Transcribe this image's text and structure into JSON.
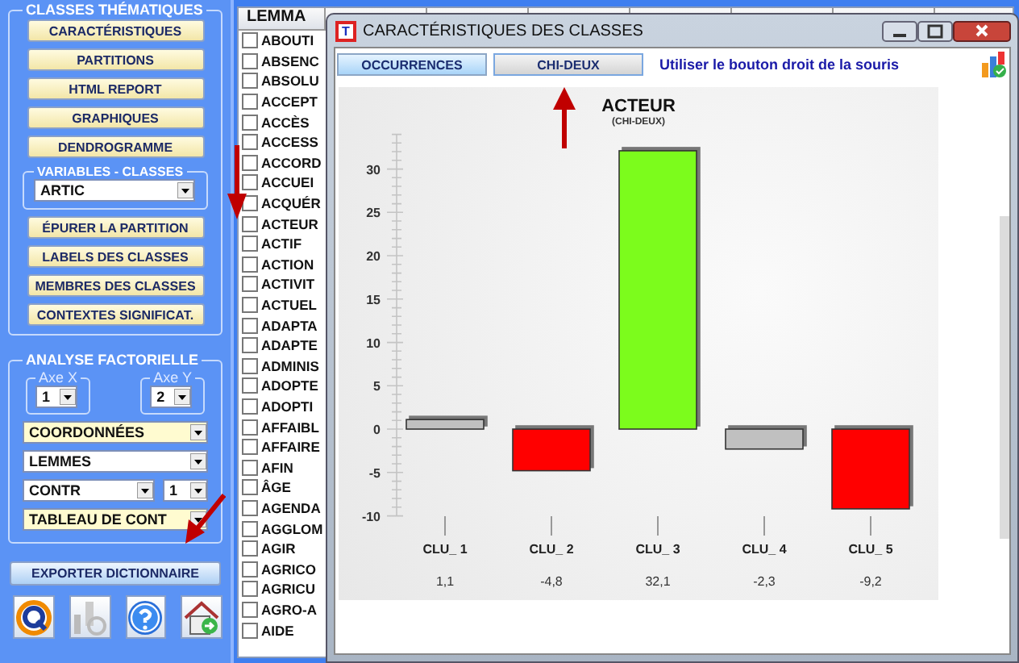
{
  "sidebar": {
    "section_title": "CLASSES THÉMATIQUES",
    "top_buttons": [
      "CARACTÉRISTIQUES",
      "PARTITIONS",
      "HTML REPORT",
      "GRAPHIQUES",
      "DENDROGRAMME"
    ],
    "variables": {
      "title": "VARIABLES - CLASSES",
      "value": "ARTIC"
    },
    "bottom_buttons": [
      "ÉPURER LA PARTITION",
      "LABELS DES CLASSES",
      "MEMBRES DES CLASSES",
      "CONTEXTES SIGNIFICAT."
    ],
    "analyse": {
      "title": "ANALYSE FACTORIELLE",
      "axes": [
        {
          "label": "Axe X",
          "value": "1"
        },
        {
          "label": "Axe Y",
          "value": "2"
        }
      ],
      "dropdown_rows": [
        [
          {
            "value": "COORDONNÉES",
            "highlighted": true
          }
        ],
        [
          {
            "value": "LEMMES",
            "highlighted": false
          }
        ],
        [
          {
            "value": "CONTR",
            "highlighted": false
          },
          {
            "value": "1",
            "highlighted": false
          }
        ],
        [
          {
            "value": "TABLEAU DE CONT",
            "highlighted": true
          }
        ]
      ]
    },
    "export_button": "EXPORTER DICTIONNAIRE"
  },
  "lemma_list": {
    "header": "LEMMA",
    "items": [
      {
        "label": "ABOUTI",
        "checked": false
      },
      {
        "label": "ABSENC",
        "checked": false
      },
      {
        "label": "ABSOLU",
        "checked": false
      },
      {
        "label": "ACCEPT",
        "checked": false
      },
      {
        "label": "ACCÈS",
        "checked": false
      },
      {
        "label": "ACCESS",
        "checked": false
      },
      {
        "label": "ACCORD",
        "checked": false
      },
      {
        "label": "ACCUEI",
        "checked": false
      },
      {
        "label": "ACQUÉR",
        "checked": false
      },
      {
        "label": "ACTEUR",
        "checked": false
      },
      {
        "label": "ACTIF",
        "checked": false
      },
      {
        "label": "ACTION",
        "checked": false
      },
      {
        "label": "ACTIVIT",
        "checked": false
      },
      {
        "label": "ACTUEL",
        "checked": false
      },
      {
        "label": "ADAPTA",
        "checked": false
      },
      {
        "label": "ADAPTE",
        "checked": false
      },
      {
        "label": "ADMINIS",
        "checked": false
      },
      {
        "label": "ADOPTE",
        "checked": false
      },
      {
        "label": "ADOPTI",
        "checked": false
      },
      {
        "label": "AFFAIBL",
        "checked": false
      },
      {
        "label": "AFFAIRE",
        "checked": false
      },
      {
        "label": "AFIN",
        "checked": false
      },
      {
        "label": "ÂGE",
        "checked": false
      },
      {
        "label": "AGENDA",
        "checked": false
      },
      {
        "label": "AGGLOM",
        "checked": false
      },
      {
        "label": "AGIR",
        "checked": false
      },
      {
        "label": "AGRICO",
        "checked": false
      },
      {
        "label": "AGRICU",
        "checked": false
      },
      {
        "label": "AGRO-A",
        "checked": false
      },
      {
        "label": "AIDE",
        "checked": false
      }
    ]
  },
  "window": {
    "icon_letter": "T",
    "title": "CARACTÉRISTIQUES DES CLASSES",
    "tabs": [
      {
        "label": "OCCURRENCES",
        "selected": false
      },
      {
        "label": "CHI-DEUX",
        "selected": true
      }
    ],
    "hint": "Utiliser le bouton droit de la souris",
    "chart_data": {
      "type": "bar",
      "title": "ACTEUR",
      "subtitle": "(CHI-DEUX)",
      "categories": [
        "CLU_ 1",
        "CLU_ 2",
        "CLU_ 3",
        "CLU_ 4",
        "CLU_ 5"
      ],
      "series": [
        {
          "values": [
            1.1,
            -4.8,
            32.1,
            -2.3,
            -9.2
          ],
          "colors": [
            "#c0c0c0",
            "#ff0000",
            "#7cfc1c",
            "#c0c0c0",
            "#ff0000"
          ]
        }
      ],
      "value_labels": [
        "1,1",
        "-4,8",
        "32,1",
        "-2,3",
        "-9,2"
      ],
      "ylim": [
        -10,
        34
      ],
      "yticks": [
        -10,
        -5,
        0,
        5,
        10,
        15,
        20,
        25,
        30
      ]
    }
  }
}
